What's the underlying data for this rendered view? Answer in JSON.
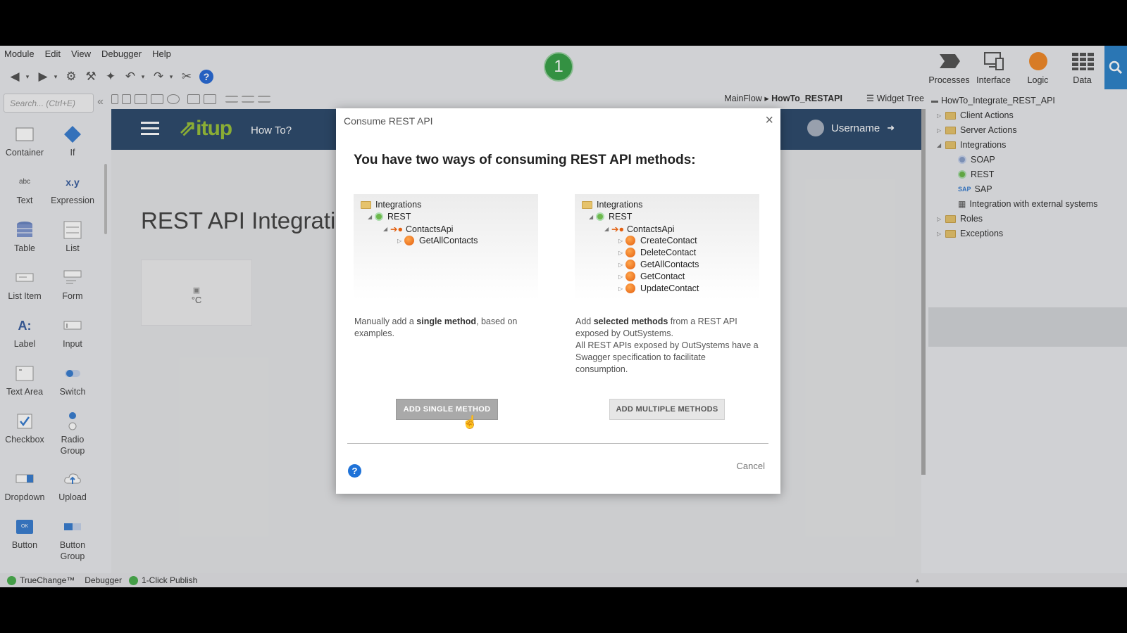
{
  "menu": [
    "Module",
    "Edit",
    "View",
    "Debugger",
    "Help"
  ],
  "step_badge": "1",
  "layer_tabs": [
    "Processes",
    "Interface",
    "Logic",
    "Data"
  ],
  "toolbox": {
    "search_placeholder": "Search... (Ctrl+E)",
    "widgets": [
      {
        "label": "Container",
        "icon": "container-icon"
      },
      {
        "label": "If",
        "icon": "if-icon"
      },
      {
        "label": "Text",
        "icon": "text-icon",
        "glyph": "abc"
      },
      {
        "label": "Expression",
        "icon": "expression-icon",
        "glyph": "x.y"
      },
      {
        "label": "Table",
        "icon": "table-icon"
      },
      {
        "label": "List",
        "icon": "list-icon"
      },
      {
        "label": "List Item",
        "icon": "list-item-icon"
      },
      {
        "label": "Form",
        "icon": "form-icon"
      },
      {
        "label": "Label",
        "icon": "label-icon",
        "glyph": "A:"
      },
      {
        "label": "Input",
        "icon": "input-icon"
      },
      {
        "label": "Text Area",
        "icon": "text-area-icon"
      },
      {
        "label": "Switch",
        "icon": "switch-icon"
      },
      {
        "label": "Checkbox",
        "icon": "checkbox-icon"
      },
      {
        "label": "Radio Group",
        "icon": "radio-group-icon"
      },
      {
        "label": "Dropdown",
        "icon": "dropdown-icon"
      },
      {
        "label": "Upload",
        "icon": "upload-icon"
      },
      {
        "label": "Button",
        "icon": "button-icon",
        "glyph": "OK"
      },
      {
        "label": "Button Group",
        "icon": "button-group-icon"
      }
    ]
  },
  "breadcrumb": {
    "parent": "MainFlow",
    "current": "HowTo_RESTAPI"
  },
  "widget_tree_label": "Widget Tree",
  "canvas": {
    "logo": "itup",
    "nav_title": "How To?",
    "username": "Username",
    "page_title": "REST API Integrati",
    "card_text": "°C"
  },
  "tree": {
    "root": "HowTo_Integrate_REST_API",
    "items": [
      "Client Actions",
      "Server Actions",
      "Integrations",
      "SOAP",
      "REST",
      "SAP",
      "Integration with external systems",
      "Roles",
      "Exceptions"
    ]
  },
  "statusbar": {
    "truechange": "TrueChange™",
    "debugger": "Debugger",
    "publish": "1-Click Publish"
  },
  "modal": {
    "title": "Consume REST API",
    "heading": "You have two ways of consuming REST API methods:",
    "left_tree": {
      "folder": "Integrations",
      "rest": "REST",
      "api": "ContactsApi",
      "methods": [
        "GetAllContacts"
      ]
    },
    "right_tree": {
      "folder": "Integrations",
      "rest": "REST",
      "api": "ContactsApi",
      "methods": [
        "CreateContact",
        "DeleteContact",
        "GetAllContacts",
        "GetContact",
        "UpdateContact"
      ]
    },
    "left_desc": {
      "p1": "Manually add a ",
      "b1": "single method",
      "p2": ", based on examples."
    },
    "right_desc": {
      "p1": "Add ",
      "b1": "selected methods",
      "p2": " from a REST API exposed by OutSystems.",
      "p3": "All REST APIs exposed by OutSystems have a Swagger specification to facilitate consumption."
    },
    "btn_single": "ADD SINGLE METHOD",
    "btn_multiple": "ADD MULTIPLE METHODS",
    "help": "?",
    "cancel": "Cancel"
  }
}
